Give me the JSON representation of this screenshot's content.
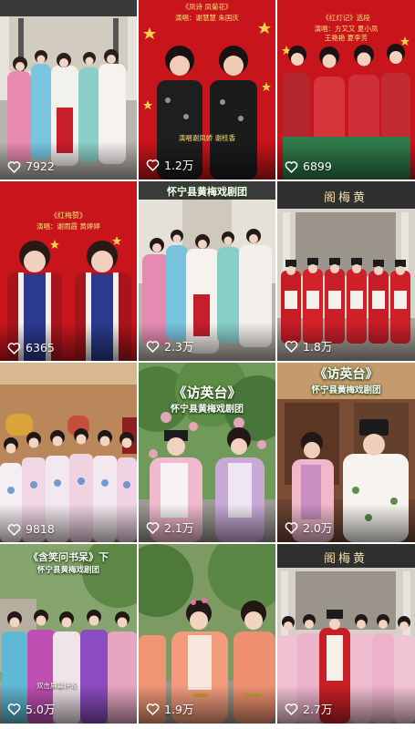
{
  "tiles": [
    {
      "likes": "7922",
      "theme": "stage-courtyard"
    },
    {
      "likes": "1.2万",
      "theme": "red-stars",
      "cap1": "《凤诗 凤菊花》",
      "cap2": "演唱：谢慧慧  朱国庆",
      "cap3": "演唱谢凤娇 谢桂香"
    },
    {
      "likes": "6899",
      "theme": "red-stars",
      "cap1": "《红灯记》选段",
      "cap2": "演唱：方又又  夏小凤",
      "cap3": "王艳艳  夏李芳"
    },
    {
      "likes": "6365",
      "theme": "red-stars",
      "cap1": "《红梅赞》",
      "cap2": "演唱：谢雨霞  黄婷婷"
    },
    {
      "likes": "2.3万",
      "theme": "stage-courtyard",
      "cap1": "怀宁县黄梅戏剧团"
    },
    {
      "likes": "1.8万",
      "theme": "hall",
      "sign": "阁梅黄"
    },
    {
      "likes": "9818",
      "theme": "interior"
    },
    {
      "likes": "2.1万",
      "theme": "garden",
      "cap1": "《访英台》",
      "cap2": "怀宁县黄梅戏剧团"
    },
    {
      "likes": "2.0万",
      "theme": "interior-wood",
      "cap1": "《访英台》",
      "cap2": "怀宁县黄梅戏剧团"
    },
    {
      "likes": "5.0万",
      "theme": "trees",
      "cap1": "《含笑问书呆》下",
      "cap2": "怀宁县黄梅戏剧团",
      "cap3": "双击屏幕评论"
    },
    {
      "likes": "1.9万",
      "theme": "trees"
    },
    {
      "likes": "2.7万",
      "theme": "hall",
      "sign": "阁梅黄"
    }
  ],
  "icons": {
    "like": "heart-outline-icon"
  },
  "colors": {
    "like_text": "#ffffff",
    "red_bg": "#c8151b",
    "gold": "#f5e27a"
  }
}
